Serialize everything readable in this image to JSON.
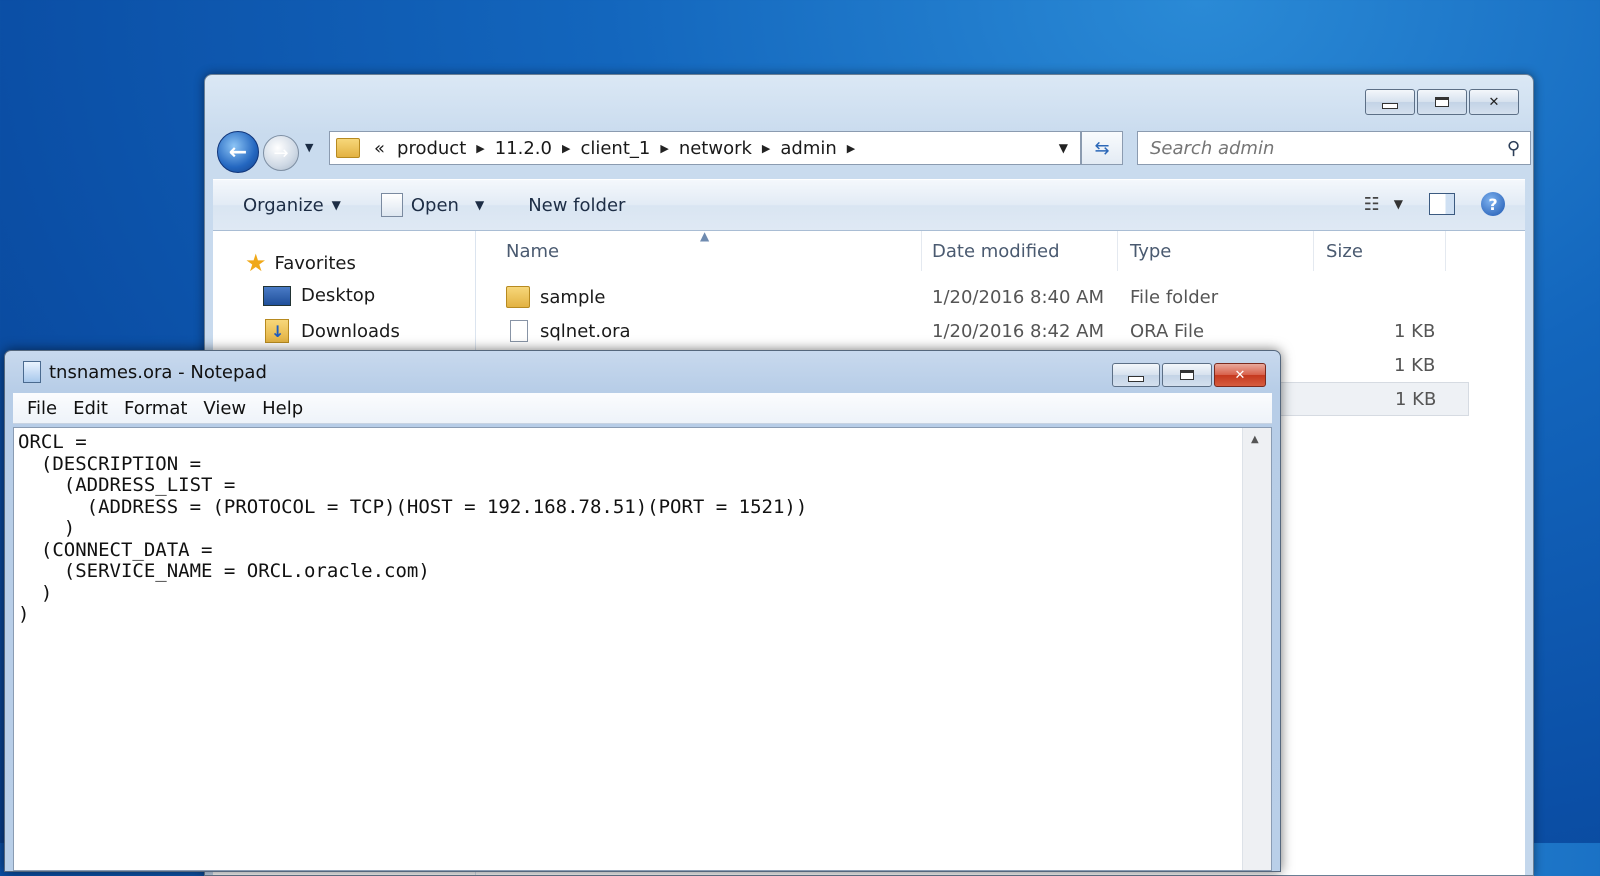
{
  "explorer": {
    "address": {
      "overflow": "«",
      "segments": [
        "product",
        "11.2.0",
        "client_1",
        "network",
        "admin"
      ]
    },
    "search_placeholder": "Search admin",
    "toolbar": {
      "organize": "Organize",
      "open": "Open",
      "new_folder": "New folder"
    },
    "nav": {
      "favorites": "Favorites",
      "desktop": "Desktop",
      "downloads": "Downloads"
    },
    "columns": {
      "name": "Name",
      "date": "Date modified",
      "type": "Type",
      "size": "Size"
    },
    "files": [
      {
        "name": "sample",
        "date": "1/20/2016 8:40 AM",
        "type": "File folder",
        "size": ""
      },
      {
        "name": "sqlnet.ora",
        "date": "1/20/2016 8:42 AM",
        "type": "ORA File",
        "size": "1 KB"
      },
      {
        "name": "",
        "date": "",
        "type": "",
        "size": "1 KB"
      },
      {
        "name": "",
        "date": "",
        "type": "",
        "size": "1 KB"
      }
    ]
  },
  "notepad": {
    "title": "tnsnames.ora - Notepad",
    "menu": [
      "File",
      "Edit",
      "Format",
      "View",
      "Help"
    ],
    "content": "ORCL =\n  (DESCRIPTION =\n    (ADDRESS_LIST =\n      (ADDRESS = (PROTOCOL = TCP)(HOST = 192.168.78.51)(PORT = 1521))\n    )\n  (CONNECT_DATA =\n    (SERVICE_NAME = ORCL.oracle.com)\n  )\n)"
  }
}
